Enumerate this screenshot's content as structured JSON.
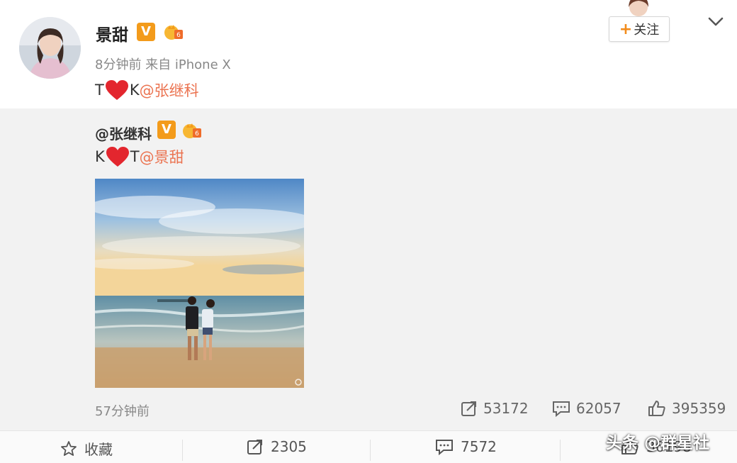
{
  "post": {
    "author": "景甜",
    "meta": "8分钟前 来自 iPhone X",
    "text_before": "T",
    "text_mid": "K",
    "mention": "@张继科",
    "follow_label": "关注"
  },
  "repost": {
    "author": "@张继科",
    "text_before": "K",
    "text_mid": "T",
    "mention": "@景甜",
    "time": "57分钟前",
    "stats": {
      "share": "53172",
      "comment": "62057",
      "like": "395359"
    }
  },
  "actions": {
    "favorite": "收藏",
    "share": "2305",
    "comment": "7572",
    "like": "36198"
  },
  "watermark": "头条 @群星社",
  "colors": {
    "accent": "#eb7350",
    "verified": "#f39b1b",
    "heart": "#e3262e"
  }
}
